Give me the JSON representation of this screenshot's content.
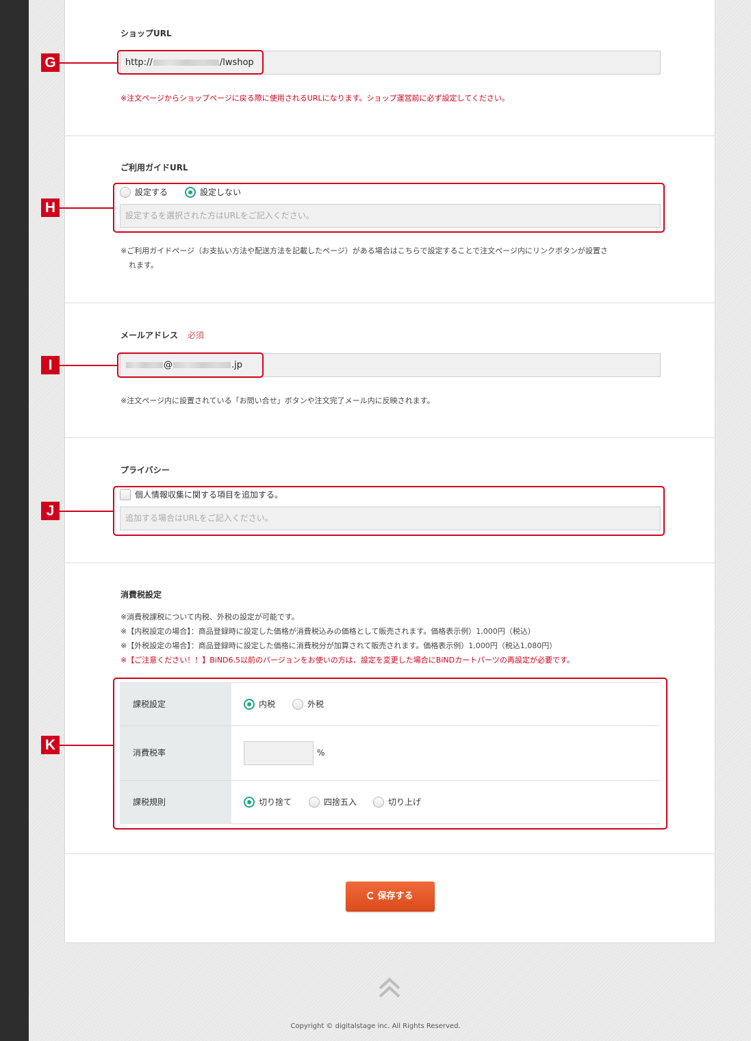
{
  "shop_url": {
    "title": "ショップURL",
    "value_prefix": "http://",
    "value_suffix": "/lwshop",
    "note": "※注文ページからショップページに戻る際に使用されるURLになります。ショップ運営前に必ず設定してください。"
  },
  "guide_url": {
    "title": "ご利用ガイドURL",
    "option_set": "設定する",
    "option_unset": "設定しない",
    "placeholder": "設定するを選択された方はURLをご記入ください。",
    "note_line1": "※ご利用ガイドページ（お支払い方法や配送方法を記載したページ）がある場合はこちらで設定することで注文ページ内にリンクボタンが設置さ",
    "note_line2": "れます。"
  },
  "email": {
    "title": "メールアドレス",
    "required": "必須",
    "value_at": "@",
    "value_suffix": ".jp",
    "note": "※注文ページ内に設置されている「お問い合せ」ボタンや注文完了メール内に反映されます。"
  },
  "privacy": {
    "title": "プライバシー",
    "checkbox_label": "個人情報収集に関する項目を追加する。",
    "placeholder": "追加する場合はURLをご記入ください。"
  },
  "tax": {
    "title": "消費税設定",
    "note1": "※消費税課税について内税、外税の設定が可能です。",
    "note2": "※【内税設定の場合】：商品登録時に設定した価格が消費税込みの価格として販売されます。価格表示例）1,000円（税込）",
    "note3": "※【外税設定の場合】：商品登録時に設定した価格に消費税分が加算されて販売されます。価格表示例）1,000円（税込1,080円）",
    "warning": "※【ご注意ください！！】BiND6.5以前のバージョンをお使いの方は、設定を変更した場合にBiNDカートパーツの再設定が必要です。",
    "row_tax_type": "課税設定",
    "opt_inclusive": "内税",
    "opt_exclusive": "外税",
    "row_tax_rate": "消費税率",
    "rate_value": "",
    "percent": "%",
    "row_rounding": "課税規則",
    "opt_round_down": "切り捨て",
    "opt_round_half": "四捨五入",
    "opt_round_up": "切り上げ"
  },
  "save_button": "保存する",
  "markers": {
    "g": "G",
    "h": "H",
    "i": "I",
    "j": "J",
    "k": "K"
  },
  "copyright": "Copyright © digitalstage inc. All Rights Reserved.",
  "colors": {
    "accent_red": "#d0021b",
    "radio_green": "#1fa38f",
    "button_orange": "#e4562a"
  }
}
